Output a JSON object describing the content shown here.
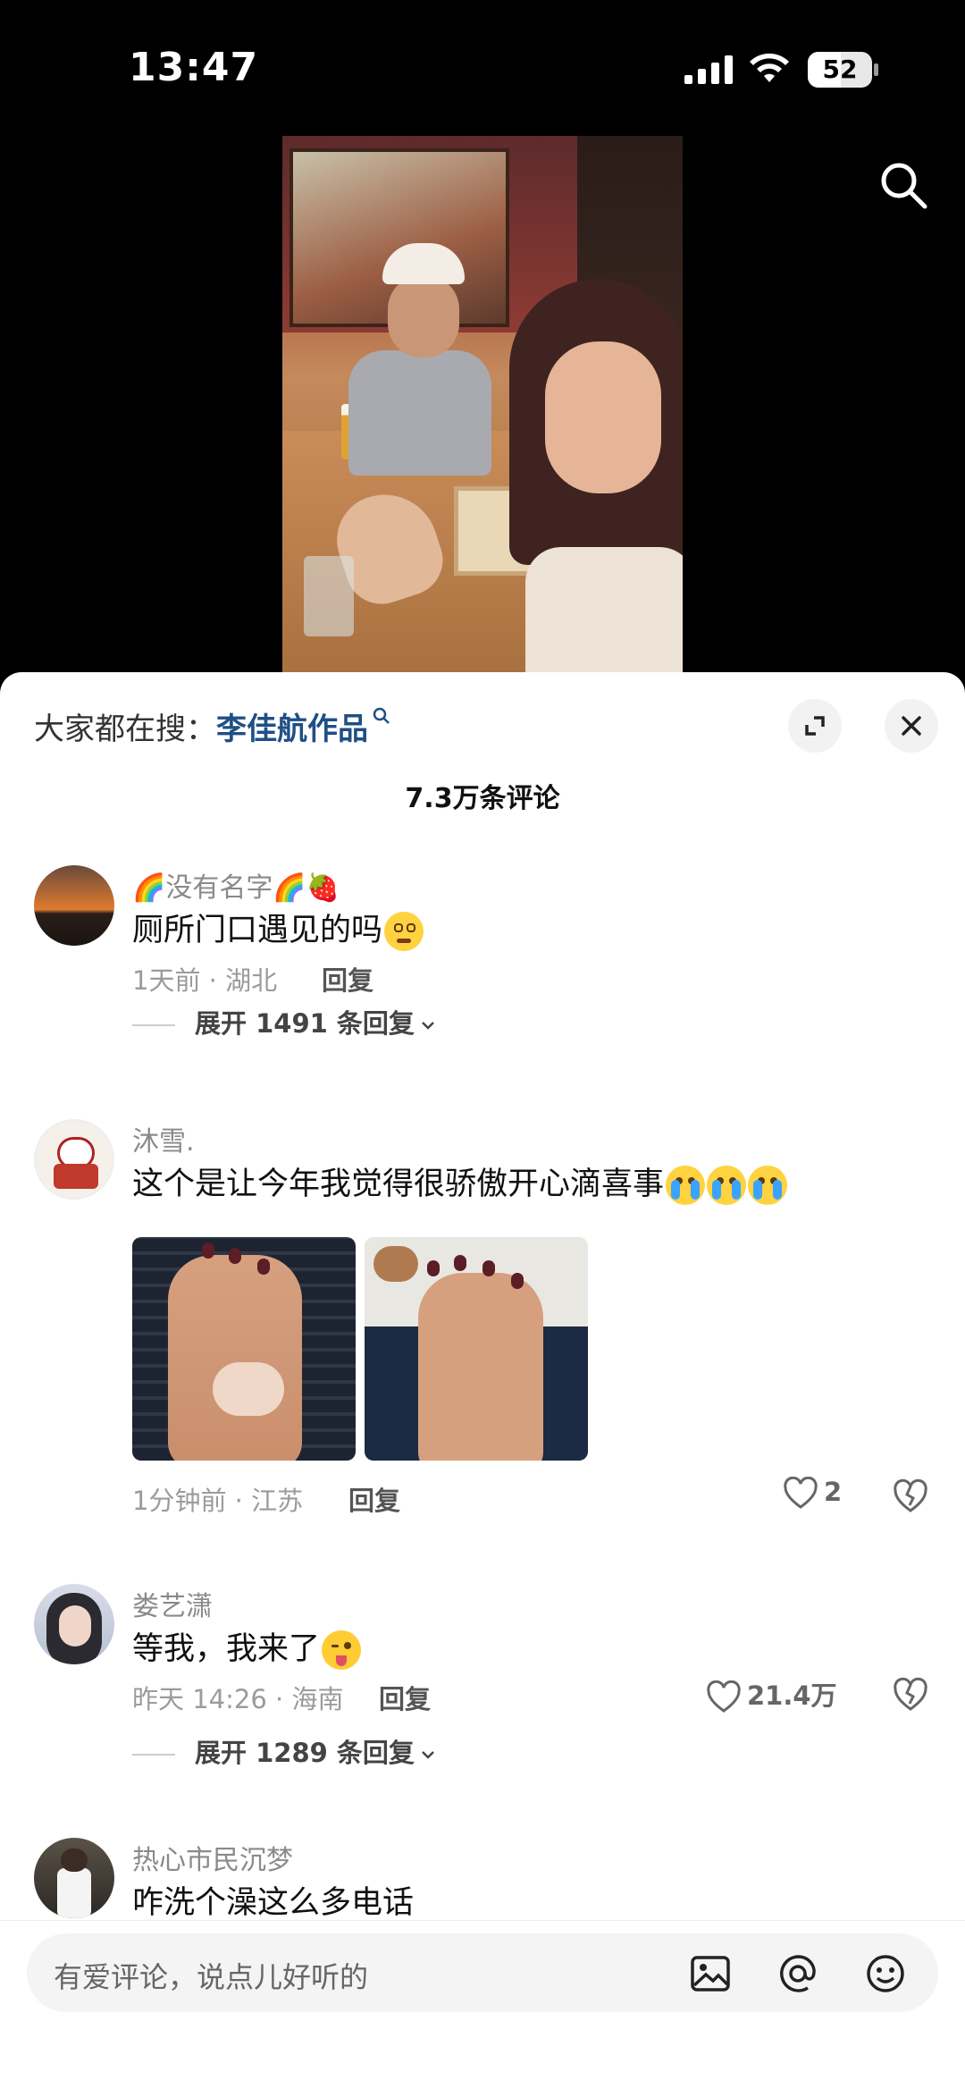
{
  "status": {
    "time": "13:47",
    "battery": "52",
    "battery_level": 0.52
  },
  "colors": {
    "accent_link": "#1f4f85",
    "meta_gray": "#9b9b9b",
    "sheet_bg": "#ffffff"
  },
  "sheet": {
    "trending_prefix": "大家都在搜：",
    "trending_link": "李佳航作品",
    "comment_count": "7.3万条评论"
  },
  "comments": [
    {
      "user": "🌈没有名字🌈🍓",
      "text": "厕所门口遇见的吗",
      "emoji": "dizzy-face",
      "time_loc": "1天前 · 湖北",
      "reply": "回复",
      "expand": "展开 1491 条回复"
    },
    {
      "user": "沐雪.",
      "text": "这个是让今年我觉得很骄傲开心滴喜事",
      "emoji": "crying-face",
      "time_loc": "1分钟前 · 江苏",
      "reply": "回复",
      "likes": "2"
    },
    {
      "user": "娄艺潇",
      "text": "等我，我来了",
      "emoji": "winking-face-tongue",
      "time_loc": "昨天 14:26 · 海南",
      "reply": "回复",
      "likes": "21.4万",
      "expand": "展开 1289 条回复"
    },
    {
      "user": "热心市民沉梦",
      "text": "咋洗个澡这么多电话"
    }
  ],
  "composer": {
    "placeholder": "有爱评论，说点儿好听的"
  }
}
